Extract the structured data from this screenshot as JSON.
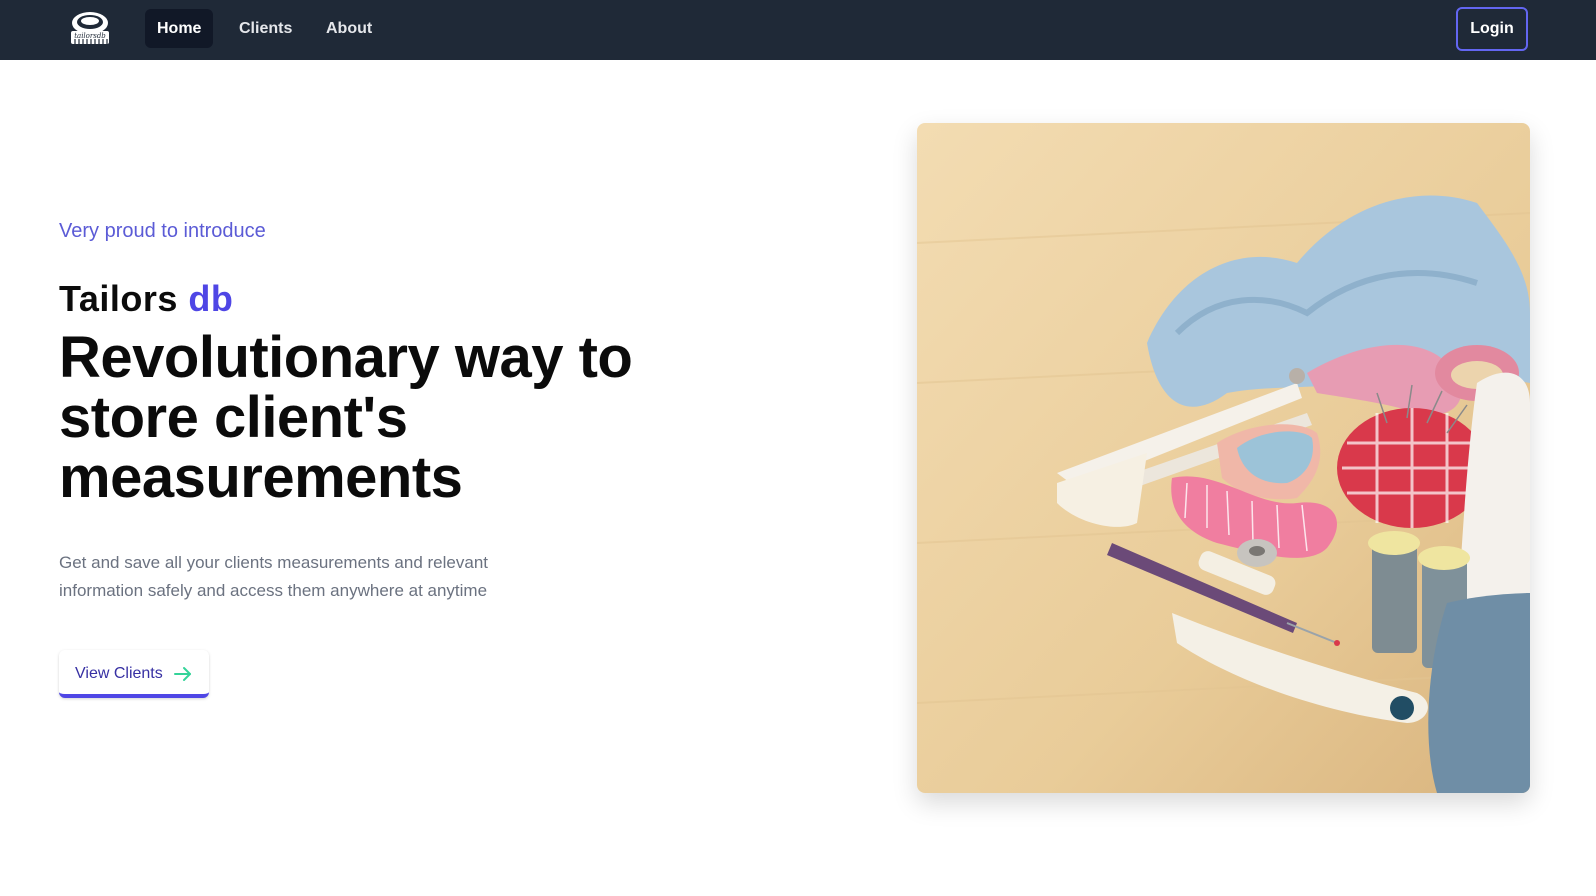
{
  "nav": {
    "logo_alt": "tailorsdb",
    "links": [
      {
        "label": "Home",
        "active": true
      },
      {
        "label": "Clients",
        "active": false
      },
      {
        "label": "About",
        "active": false
      }
    ],
    "login_label": "Login"
  },
  "hero": {
    "eyebrow": "Very proud to introduce",
    "brand_prefix": "Tailors",
    "brand_accent": "db",
    "headline": "Revolutionary way to store client's measurements",
    "description": "Get and save all your clients measurements and relevant information safely and access them anywhere at anytime",
    "cta_label": "View Clients",
    "cta_icon": "arrow-right-icon",
    "image_subject": "sewing-tools-photo"
  },
  "colors": {
    "navbar_bg": "#1f2937",
    "accent": "#4f46e5",
    "login_border": "#6366f1",
    "cta_arrow": "#34d399"
  }
}
